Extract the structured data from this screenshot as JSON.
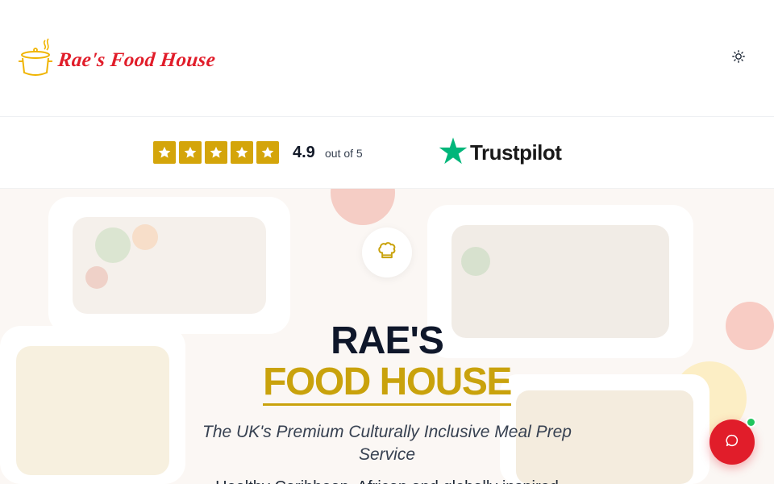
{
  "header": {
    "logo_text": "Rae's Food House",
    "logo_icon": "cooking-pot-icon",
    "theme_toggle_icon": "sun-icon"
  },
  "rating": {
    "stars": 5,
    "value": "4.9",
    "suffix": "out of 5",
    "provider": "Trustpilot",
    "star_color": "#d4a50a"
  },
  "hero": {
    "badge_icon": "chef-hat-icon",
    "title_line1": "RAE'S",
    "title_line2": "FOOD HOUSE",
    "subtitle": "The UK's Premium Culturally Inclusive Meal Prep Service",
    "description": "Healthy Caribbean, African and globally inspired"
  },
  "chat": {
    "icon": "chat-bubble-icon",
    "status": "online"
  },
  "colors": {
    "brand_red": "#e11d2a",
    "brand_gold": "#c9a20c",
    "trustpilot_green": "#00b67a"
  }
}
